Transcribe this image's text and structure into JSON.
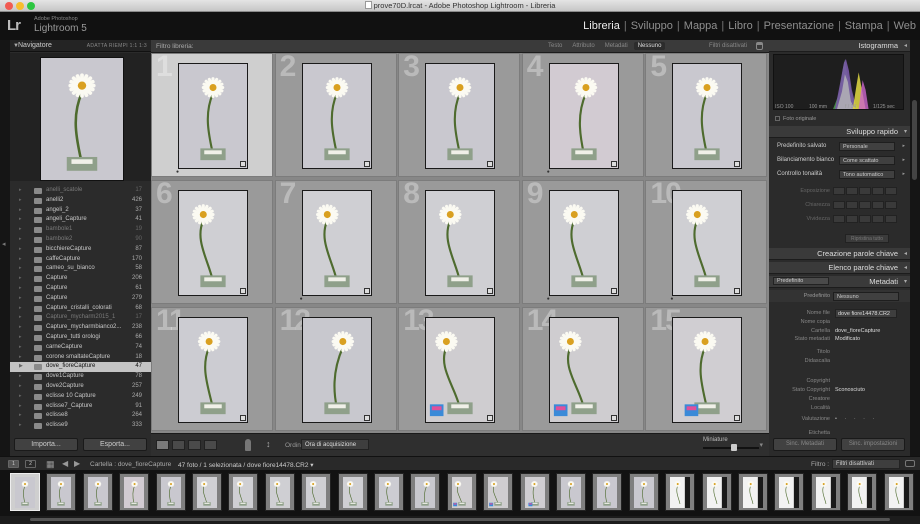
{
  "window": {
    "title": "prove70D.lrcat - Adobe Photoshop Lightroom - Libreria"
  },
  "identity": {
    "logo": "Lr",
    "vendor": "Adobe Photoshop",
    "product": "Lightroom 5"
  },
  "modules": [
    {
      "label": "Libreria",
      "active": true
    },
    {
      "label": "Sviluppo",
      "active": false
    },
    {
      "label": "Mappa",
      "active": false
    },
    {
      "label": "Libro",
      "active": false
    },
    {
      "label": "Presentazione",
      "active": false
    },
    {
      "label": "Stampa",
      "active": false
    },
    {
      "label": "Web",
      "active": false
    }
  ],
  "navigator": {
    "title": "Navigatore",
    "options": "ADATTA  RIEMPI  1:1  1:3"
  },
  "folders": [
    {
      "name": "anelli_scatole",
      "count": "17",
      "dim": true
    },
    {
      "name": "anelli2",
      "count": "426"
    },
    {
      "name": "angeli_2",
      "count": "37"
    },
    {
      "name": "angeli_Capture",
      "count": "41"
    },
    {
      "name": "bambole1",
      "count": "19",
      "dim": true
    },
    {
      "name": "bambole2",
      "count": "90",
      "dim": true
    },
    {
      "name": "bicchiereCapture",
      "count": "87"
    },
    {
      "name": "caffeCapture",
      "count": "170"
    },
    {
      "name": "cameo_su_bianco",
      "count": "58"
    },
    {
      "name": "Capture",
      "count": "206"
    },
    {
      "name": "Capture",
      "count": "61"
    },
    {
      "name": "Capture",
      "count": "279"
    },
    {
      "name": "Capture_cristalli_colorati",
      "count": "68"
    },
    {
      "name": "Capture_mycharm2015_1",
      "count": "17",
      "dim": true
    },
    {
      "name": "Capture_mycharmbianco2...",
      "count": "238"
    },
    {
      "name": "Capture_tutti orologi",
      "count": "66"
    },
    {
      "name": "carneCapture",
      "count": "74"
    },
    {
      "name": "corone smaltateCapture",
      "count": "18"
    },
    {
      "name": "dove_fioreCapture",
      "count": "47",
      "selected": true
    },
    {
      "name": "dove1Capture",
      "count": "78"
    },
    {
      "name": "dove2Capture",
      "count": "257"
    },
    {
      "name": "eclisse 10 Capture",
      "count": "249"
    },
    {
      "name": "eclisse7_Capture",
      "count": "91"
    },
    {
      "name": "eclisse8",
      "count": "264"
    },
    {
      "name": "eclisse9",
      "count": "333"
    }
  ],
  "left_buttons": {
    "import": "Importa...",
    "export": "Esporta..."
  },
  "filterbar": {
    "label": "Filtro libreria:",
    "tabs": [
      {
        "label": "Testo",
        "active": false
      },
      {
        "label": "Attributo",
        "active": false
      },
      {
        "label": "Metadati",
        "active": false
      },
      {
        "label": "Nessuno",
        "active": true
      }
    ],
    "status": "Filtri disattivati"
  },
  "grid": {
    "cells": [
      {
        "num": "1",
        "selected": true,
        "variant": "a",
        "dot": true
      },
      {
        "num": "2",
        "variant": "a",
        "dot": false
      },
      {
        "num": "3",
        "variant": "a",
        "dot": false
      },
      {
        "num": "4",
        "variant": "b",
        "dot": true
      },
      {
        "num": "5",
        "variant": "a",
        "dot": false
      },
      {
        "num": "6",
        "variant": "c",
        "dot": false
      },
      {
        "num": "7",
        "variant": "c",
        "dot": true
      },
      {
        "num": "8",
        "variant": "c",
        "dot": false
      },
      {
        "num": "9",
        "variant": "c",
        "dot": true
      },
      {
        "num": "10",
        "variant": "c",
        "dot": true
      },
      {
        "num": "11",
        "variant": "d",
        "dot": false
      },
      {
        "num": "12",
        "variant": "e",
        "dot": false
      },
      {
        "num": "13",
        "variant": "f",
        "dot": false
      },
      {
        "num": "14",
        "variant": "f",
        "dot": false
      },
      {
        "num": "15",
        "variant": "g",
        "dot": false
      }
    ]
  },
  "toolbar": {
    "sort_label": "Ordina:",
    "sort_value": "Ora di acquisizione",
    "thumbsize_label": "Miniature",
    "thumbsize_level": 0.55
  },
  "histogram": {
    "title": "Istogramma",
    "iso": "ISO 100",
    "focal": "100 mm",
    "aperture": "f / 14",
    "shutter": "1/125 sec",
    "original_label": "Foto originale"
  },
  "quick_develop": {
    "title": "Sviluppo rapido",
    "rows": [
      {
        "label": "Predefinito salvato",
        "value": "Personale"
      },
      {
        "label": "Bilanciamento bianco",
        "value": "Come scattato"
      },
      {
        "label": "Controllo tonalità",
        "value": "Tono automatico"
      }
    ],
    "adjust": [
      "Esposizione",
      "Chiarezza",
      "Vividezza"
    ],
    "reset": "Ripristina tutto"
  },
  "sections": {
    "keyword_creation": "Creazione parole chiave",
    "keyword_list": "Elenco parole chiave",
    "metadata": "Metadati"
  },
  "metadata": {
    "preset_select": "Predefinito",
    "preset_label": "Predefinito",
    "preset_value": "Nessuno",
    "rows": [
      {
        "label": "Nome file",
        "value": "dove fiore14478.CR2",
        "box": true
      },
      {
        "label": "Nome copia",
        "value": ""
      },
      {
        "label": "Cartella",
        "value": "dove_fioreCapture"
      },
      {
        "label": "Stato metadati",
        "value": "Modificato"
      },
      {
        "label": "Titolo",
        "value": ""
      },
      {
        "label": "Didascalia",
        "value": ""
      },
      {
        "label": "Copyright",
        "value": ""
      },
      {
        "label": "Stato Copyright",
        "value": "Sconosciuto"
      },
      {
        "label": "Creatore",
        "value": ""
      },
      {
        "label": "Località",
        "value": ""
      },
      {
        "label": "Valutazione",
        "value": "• · · · ·",
        "stars": true
      },
      {
        "label": "Etichetta",
        "value": ""
      }
    ]
  },
  "right_buttons": {
    "sync_meta": "Sinc. Metadati",
    "sync_settings": "Sinc. impostazioni"
  },
  "filmstrip_bar": {
    "btn1": "1",
    "btn2": "2",
    "source": "Cartella : dove_fioreCapture",
    "count": "47 foto / 1 selezionata / dove fiore14478.CR2 ▾",
    "filter_label": "Filtro :",
    "filter_value": "Filtri disattivati"
  },
  "filmstrip": [
    {
      "selected": true,
      "variant": "a"
    },
    {
      "variant": "a"
    },
    {
      "variant": "a"
    },
    {
      "variant": "b"
    },
    {
      "variant": "a"
    },
    {
      "variant": "c"
    },
    {
      "variant": "c"
    },
    {
      "variant": "c"
    },
    {
      "variant": "c"
    },
    {
      "variant": "c"
    },
    {
      "variant": "d"
    },
    {
      "variant": "e"
    },
    {
      "variant": "f"
    },
    {
      "variant": "f"
    },
    {
      "variant": "g"
    },
    {
      "variant": "a"
    },
    {
      "variant": "a"
    },
    {
      "variant": "a"
    },
    {
      "variant": "h"
    },
    {
      "variant": "h"
    },
    {
      "variant": "h"
    },
    {
      "variant": "h"
    },
    {
      "variant": "h"
    },
    {
      "variant": "h"
    },
    {
      "variant": "h"
    }
  ]
}
